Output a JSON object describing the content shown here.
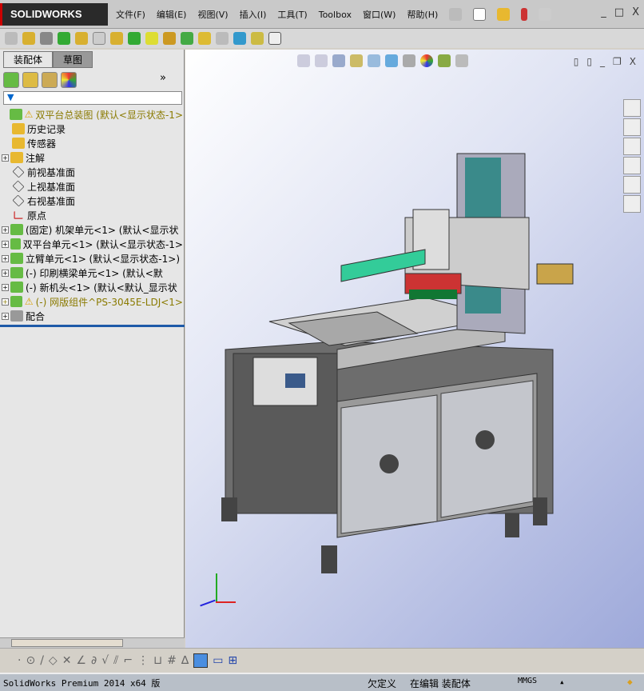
{
  "app": {
    "logo": "SOLIDWORKS"
  },
  "menu": [
    "文件(F)",
    "编辑(E)",
    "视图(V)",
    "插入(I)",
    "工具(T)",
    "Toolbox",
    "窗口(W)",
    "帮助(H)"
  ],
  "tabs": [
    "装配体",
    "草图"
  ],
  "tree": [
    {
      "label": "双平台总装图  (默认<显示状态-1>",
      "warn": true,
      "exp": false,
      "icon": "assembly-warning"
    },
    {
      "label": "历史记录",
      "icon": "history"
    },
    {
      "label": "传感器",
      "icon": "sensor"
    },
    {
      "label": "注解",
      "exp": true,
      "icon": "annotation"
    },
    {
      "label": "前视基准面",
      "icon": "plane"
    },
    {
      "label": "上视基准面",
      "icon": "plane"
    },
    {
      "label": "右视基准面",
      "icon": "plane"
    },
    {
      "label": "原点",
      "icon": "origin"
    },
    {
      "label": "(固定) 机架单元<1> (默认<显示状",
      "exp": true,
      "icon": "assembly"
    },
    {
      "label": "双平台单元<1> (默认<显示状态-1>",
      "exp": true,
      "icon": "assembly"
    },
    {
      "label": "立臂单元<1> (默认<显示状态-1>)",
      "exp": true,
      "icon": "assembly"
    },
    {
      "label": "(-) 印刷横梁单元<1> (默认<默",
      "exp": true,
      "icon": "assembly"
    },
    {
      "label": "(-) 新机头<1> (默认<默认_显示状",
      "exp": true,
      "icon": "assembly"
    },
    {
      "label": "(-) 网版组件^PS-3045E-LDJ<1>",
      "exp": true,
      "warn": true,
      "icon": "assembly-warning"
    },
    {
      "label": "配合",
      "exp": true,
      "icon": "mates"
    }
  ],
  "status": {
    "product": "SolidWorks Premium 2014 x64 版",
    "state": "欠定义",
    "editing": "在编辑 装配体",
    "units": "MMGS"
  },
  "colors": {
    "accent": "#1e5aa8",
    "warn": "#8a7a00"
  }
}
